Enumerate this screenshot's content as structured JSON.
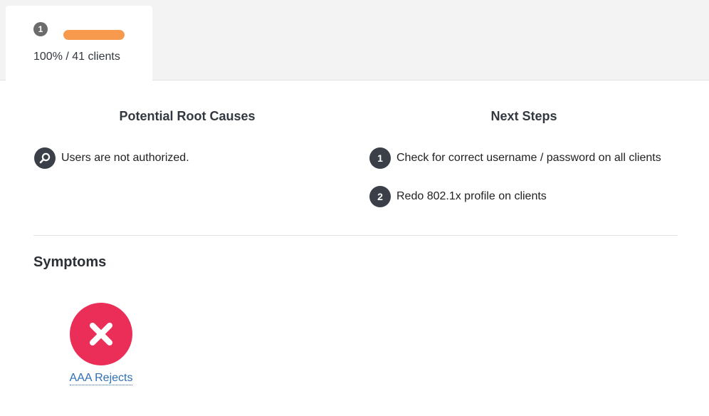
{
  "tab": {
    "badge": "1",
    "progress_fraction": 1.0,
    "progress_color": "#f79a4e",
    "stat": "100% / 41 clients"
  },
  "root_causes": {
    "title": "Potential Root Causes",
    "items": [
      {
        "icon": "search-icon",
        "text": "Users are not authorized."
      }
    ]
  },
  "next_steps": {
    "title": "Next Steps",
    "items": [
      {
        "number": "1",
        "text": "Check for correct username / password on all clients"
      },
      {
        "number": "2",
        "text": "Redo 802.1x profile on clients"
      }
    ]
  },
  "symptoms": {
    "title": "Symptoms",
    "items": [
      {
        "icon": "x-icon",
        "color": "#ea2e58",
        "label": "AAA Rejects"
      }
    ]
  }
}
